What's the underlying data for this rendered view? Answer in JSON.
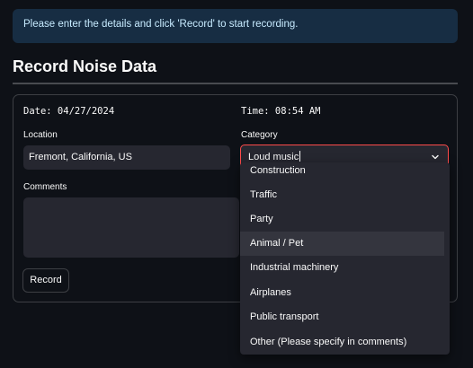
{
  "info_banner": {
    "text": "Please enter the details and click 'Record' to start recording."
  },
  "page_title": "Record Noise Data",
  "form": {
    "date_text": "Date: 04/27/2024",
    "time_text": "Time: 08:54 AM",
    "location_label": "Location",
    "location_value": "Fremont, California, US",
    "category_label": "Category",
    "category_value": "Loud music",
    "comments_label": "Comments",
    "comments_value": "",
    "record_button_label": "Record"
  },
  "category_dropdown": {
    "options": [
      "Construction",
      "Traffic",
      "Party",
      "Animal / Pet",
      "Industrial machinery",
      "Airplanes",
      "Public transport",
      "Other (Please specify in comments)"
    ],
    "hovered_option": "Animal / Pet"
  },
  "colors": {
    "background": "#0e1117",
    "banner_bg": "#172d43",
    "banner_text": "#c7ebff",
    "input_bg": "#262730",
    "focus_border": "#ff4b4b"
  },
  "icons": {
    "select_toggle": "chevron-down-icon"
  }
}
